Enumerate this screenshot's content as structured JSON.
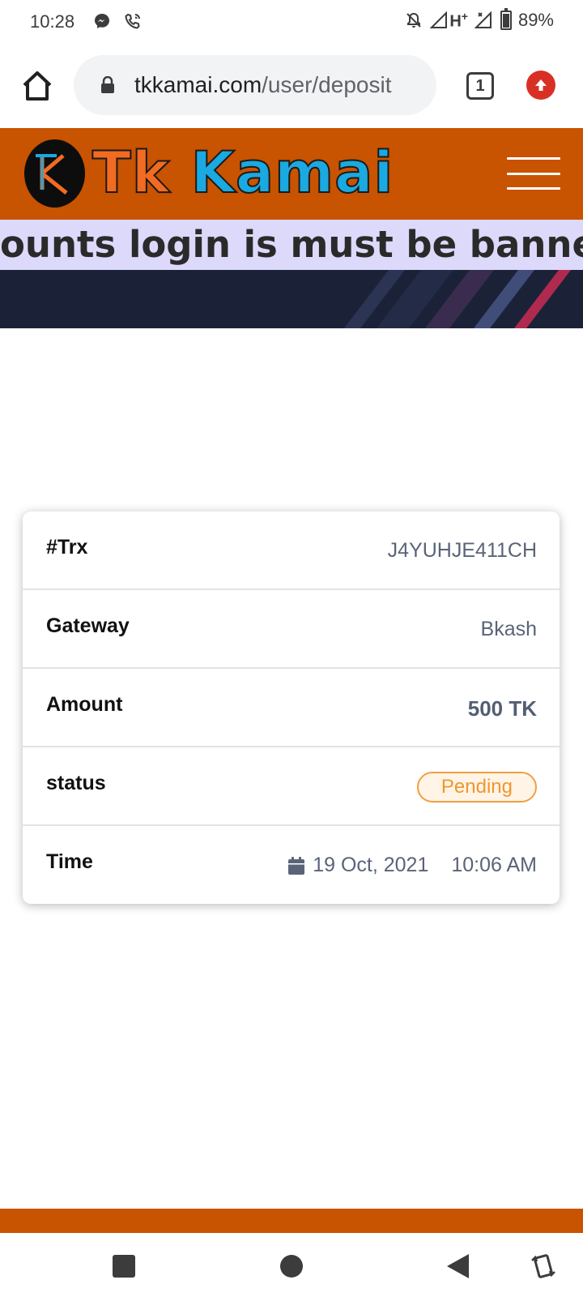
{
  "status_bar": {
    "time": "10:28",
    "left_icons": [
      "messenger-icon",
      "wifi-call-icon"
    ],
    "right_icons": [
      "mute-icon",
      "signal-hplus-icon",
      "signal-icon",
      "battery-icon"
    ],
    "battery": "89%",
    "battery_level": 0.89
  },
  "browser": {
    "url_domain": "tkkamai.com",
    "url_path": "/user/deposit",
    "tab_count": "1"
  },
  "site": {
    "logo_tk": "Tk",
    "logo_kamai": "Kamai",
    "marquee": "ounts login is must be banned f",
    "colors": {
      "header": "#c85300",
      "marquee_bg": "#dcd9fa",
      "banner": "#1b2238",
      "pending": "#f0962e"
    }
  },
  "deposit": {
    "rows": [
      {
        "label": "#Trx",
        "value": "J4YUHJE411CH"
      },
      {
        "label": "Gateway",
        "value": "Bkash"
      },
      {
        "label": "Amount",
        "value": "500 TK"
      },
      {
        "label": "status",
        "value": "Pending"
      },
      {
        "label": "Time",
        "date": "19 Oct, 2021",
        "time": "10:06 AM"
      }
    ]
  },
  "nav_bar": {
    "icons": [
      "recents-icon",
      "home-icon",
      "back-icon",
      "rotate-icon"
    ]
  }
}
